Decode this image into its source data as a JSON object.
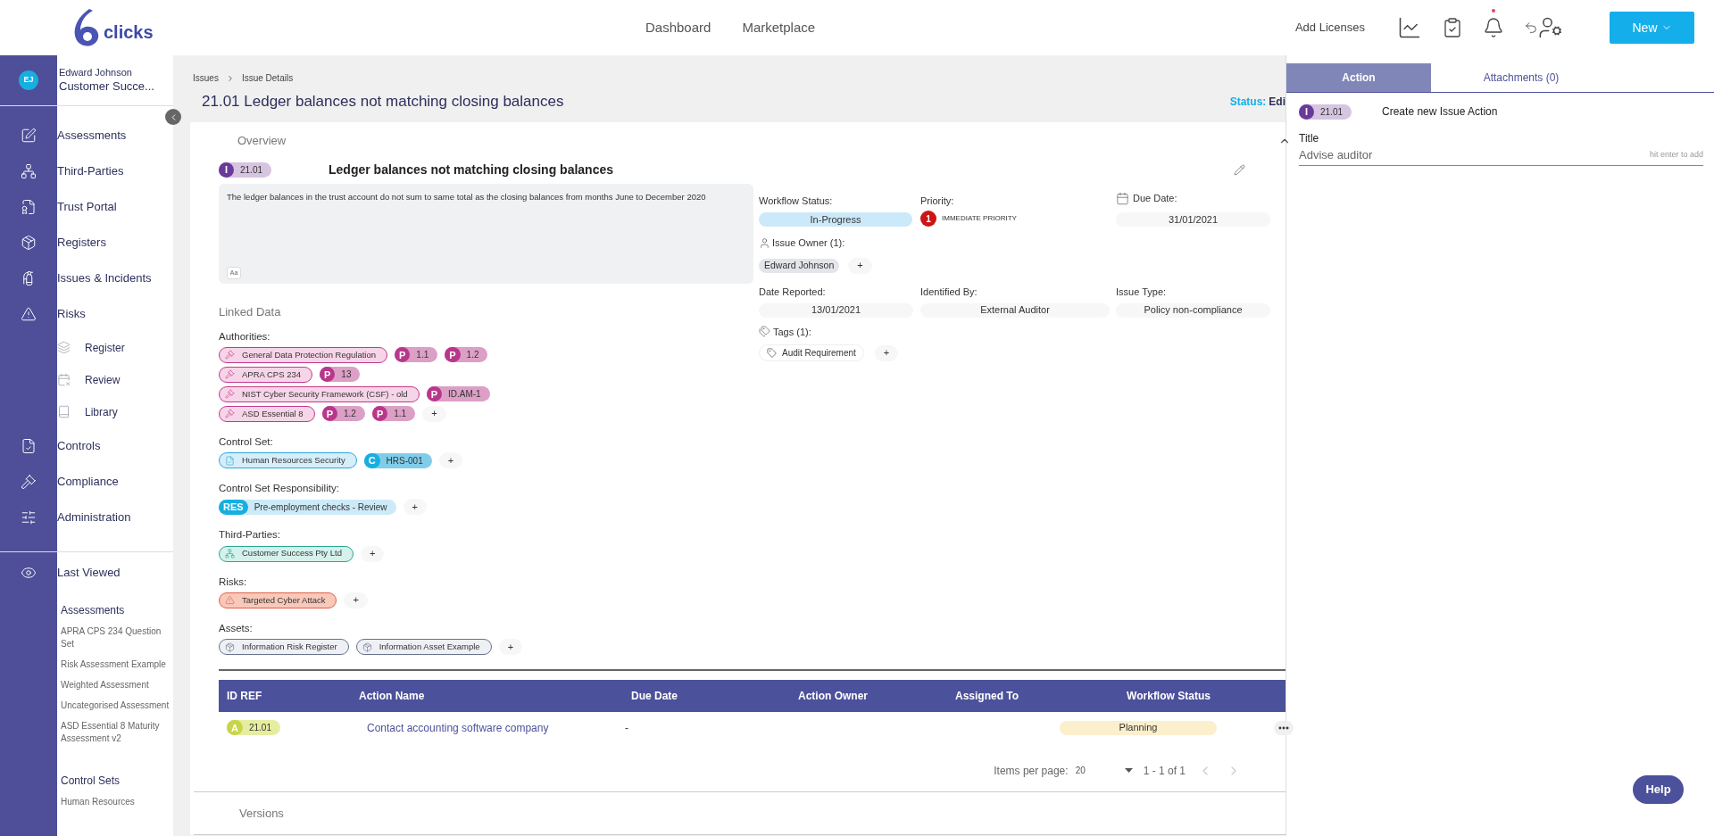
{
  "header": {
    "logo_text": "clicks",
    "nav": [
      {
        "label": "Dashboard"
      },
      {
        "label": "Marketplace"
      }
    ],
    "add_licenses": "Add Licenses",
    "new_button": "New"
  },
  "sidebar": {
    "user": {
      "initials": "EJ",
      "name": "Edward Johnson",
      "role": "Customer Succe..."
    },
    "items": [
      {
        "label": "Assessments",
        "kind": "main"
      },
      {
        "label": "Third-Parties",
        "kind": "main"
      },
      {
        "label": "Trust Portal",
        "kind": "main"
      },
      {
        "label": "Registers",
        "kind": "main"
      },
      {
        "label": "Issues & Incidents",
        "kind": "main"
      },
      {
        "label": "Risks",
        "kind": "main"
      },
      {
        "label": "Register",
        "kind": "sub"
      },
      {
        "label": "Review",
        "kind": "sub"
      },
      {
        "label": "Library",
        "kind": "sub"
      },
      {
        "label": "Controls",
        "kind": "main"
      },
      {
        "label": "Compliance",
        "kind": "main"
      },
      {
        "label": "Administration",
        "kind": "main"
      }
    ],
    "last_viewed": {
      "label": "Last Viewed",
      "groups": [
        {
          "title": "Assessments",
          "items": [
            "APRA CPS 234 Question Set",
            "Risk Assessment Example",
            "Weighted Assessment",
            "Uncategorised Assessment",
            "ASD Essential 8 Maturity Assessment v2"
          ]
        },
        {
          "title": "Control Sets",
          "items": [
            "Human Resources"
          ]
        }
      ]
    }
  },
  "breadcrumb": [
    "Issues",
    "Issue Details"
  ],
  "page_title": "21.01 Ledger balances not matching closing balances",
  "status": {
    "label": "Status:",
    "value": "Edi"
  },
  "overview": {
    "heading": "Overview",
    "badge": {
      "letter": "I",
      "ref": "21.01"
    },
    "title": "Ledger balances not matching closing balances",
    "description": "The ledger balances in the trust account do not sum to same total as the closing balances from months June to December 2020",
    "format_button": "Aa",
    "fields": {
      "workflow_status": {
        "label": "Workflow Status:",
        "value": "In-Progress"
      },
      "priority": {
        "label": "Priority:",
        "number": "1",
        "value": "IMMEDIATE PRIORITY"
      },
      "due_date": {
        "label": "Due Date:",
        "value": "31/01/2021"
      },
      "issue_owner": {
        "label": "Issue Owner (1):",
        "people": [
          "Edward Johnson"
        ],
        "add": "+"
      },
      "date_reported": {
        "label": "Date Reported:",
        "value": "13/01/2021"
      },
      "identified_by": {
        "label": "Identified By:",
        "value": "External Auditor"
      },
      "issue_type": {
        "label": "Issue Type:",
        "value": "Policy non-compliance"
      },
      "tags": {
        "label": "Tags (1):",
        "items": [
          "Audit Requirement"
        ],
        "add": "+"
      }
    }
  },
  "linked_data": {
    "heading": "Linked Data",
    "sections": [
      {
        "label": "Authorities:",
        "kind": "authority",
        "rows": [
          [
            {
              "kind": "entity",
              "label": "General Data Protection Regulation"
            },
            {
              "kind": "ref",
              "letter": "P",
              "label": "1.1"
            },
            {
              "kind": "ref",
              "letter": "P",
              "label": "1.2"
            }
          ],
          [
            {
              "kind": "entity",
              "label": "APRA CPS 234"
            },
            {
              "kind": "ref",
              "letter": "P",
              "label": "13"
            }
          ],
          [
            {
              "kind": "entity",
              "label": "NIST Cyber Security Framework (CSF) - old"
            },
            {
              "kind": "ref",
              "letter": "P",
              "label": "ID.AM-1"
            }
          ],
          [
            {
              "kind": "entity",
              "label": "ASD Essential 8"
            },
            {
              "kind": "ref",
              "letter": "P",
              "label": "1.2"
            },
            {
              "kind": "ref",
              "letter": "P",
              "label": "1.1"
            }
          ]
        ],
        "add": "+"
      },
      {
        "label": "Control Set:",
        "kind": "control_set",
        "rows": [
          [
            {
              "kind": "entity",
              "label": "Human Resources Security"
            },
            {
              "kind": "ref",
              "letter": "C",
              "label": "HRS-001"
            }
          ]
        ],
        "add": "+"
      },
      {
        "label": "Control Set Responsibility:",
        "kind": "responsibility",
        "rows": [
          [
            {
              "kind": "ref",
              "letter": "RES",
              "label": "Pre-employment checks - Review"
            }
          ]
        ],
        "add": "+"
      },
      {
        "label": "Third-Parties:",
        "kind": "third_party",
        "rows": [
          [
            {
              "kind": "entity",
              "label": "Customer Success Pty Ltd"
            }
          ]
        ],
        "add": "+"
      },
      {
        "label": "Risks:",
        "kind": "risk",
        "rows": [
          [
            {
              "kind": "entity",
              "label": "Targeted Cyber Attack"
            }
          ]
        ],
        "add": "+"
      },
      {
        "label": "Assets:",
        "kind": "asset",
        "rows": [
          [
            {
              "kind": "entity",
              "label": "Information Risk Register"
            },
            {
              "kind": "entity",
              "label": "Information Asset Example"
            }
          ]
        ],
        "add": "+"
      }
    ]
  },
  "actions_table": {
    "columns": [
      "ID REF",
      "Action Name",
      "Due Date",
      "Action Owner",
      "Assigned To",
      "Workflow Status"
    ],
    "rows": [
      {
        "letter": "A",
        "ref": "21.01",
        "name": "Contact accounting software company",
        "due": "-",
        "status": "Planning"
      }
    ],
    "pagination": {
      "label": "Items per page:",
      "size": "20",
      "range": "1 - 1 of 1"
    }
  },
  "versions": {
    "heading": "Versions"
  },
  "panel": {
    "tabs": [
      {
        "label": "Action",
        "selected": true
      },
      {
        "label": "Attachments (0)",
        "selected": false
      }
    ],
    "badge": {
      "letter": "I",
      "ref": "21.01"
    },
    "heading": "Create new Issue Action",
    "field": {
      "label": "Title",
      "value": "Advise auditor",
      "hint": "hit enter to add"
    }
  },
  "help_button": "Help"
}
